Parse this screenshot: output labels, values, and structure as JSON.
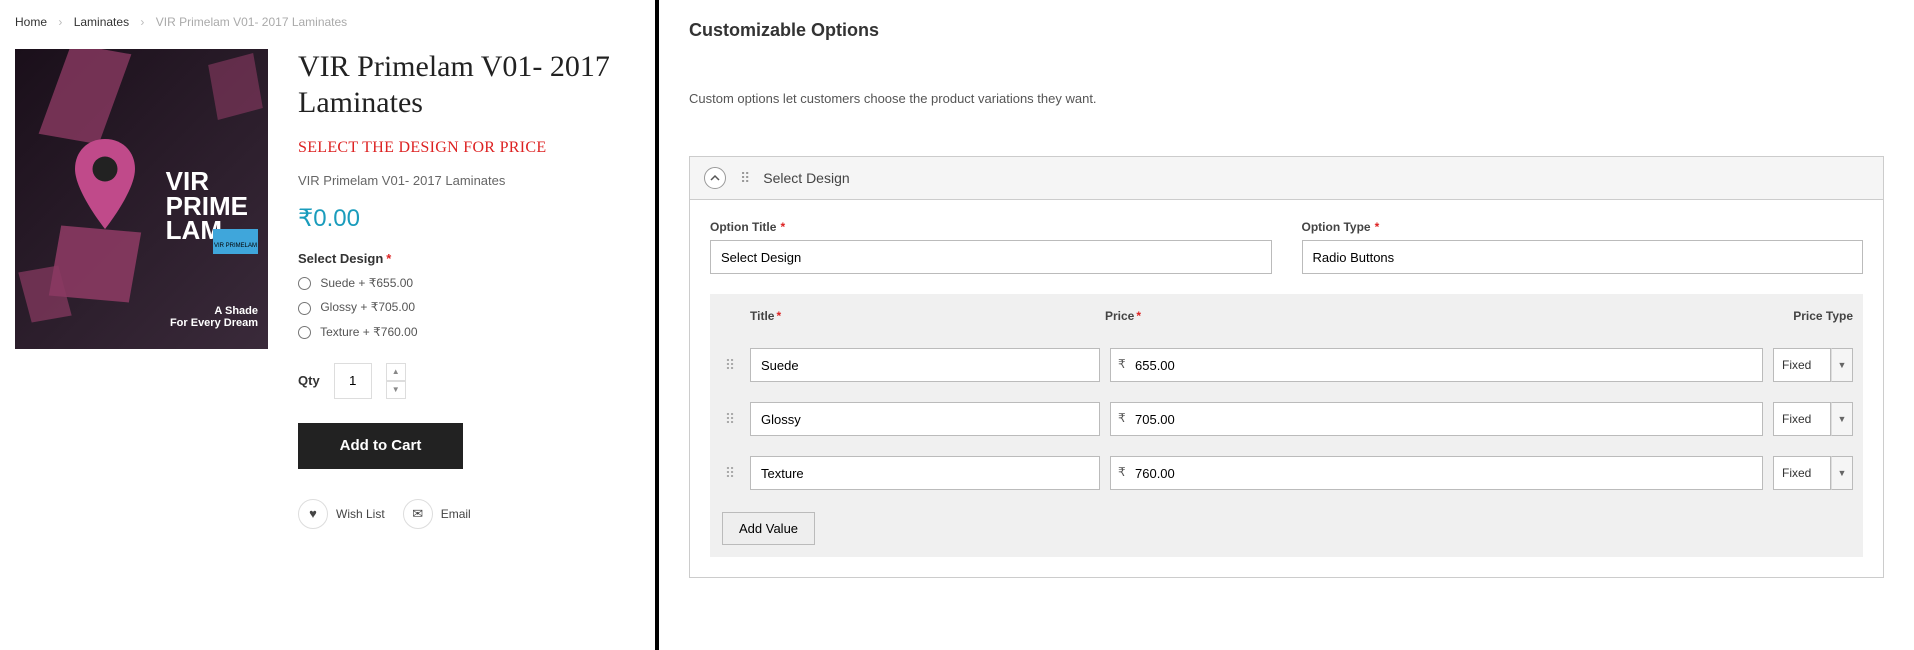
{
  "breadcrumb": {
    "home": "Home",
    "cat": "Laminates",
    "current": "VIR Primelam V01- 2017 Laminates"
  },
  "product": {
    "title": "VIR Primelam V01- 2017 Laminates",
    "select_msg": "SELECT THE DESIGN FOR PRICE",
    "subtitle": "VIR Primelam V01- 2017 Laminates",
    "price": "₹0.00",
    "option_label": "Select Design",
    "options": [
      {
        "label": "Suede + ₹655.00"
      },
      {
        "label": "Glossy + ₹705.00"
      },
      {
        "label": "Texture + ₹760.00"
      }
    ],
    "qty_label": "Qty",
    "qty_value": "1",
    "add_label": "Add to Cart",
    "wish_label": "Wish List",
    "email_label": "Email",
    "image": {
      "big_line1": "VIR",
      "big_line2": "PRIME",
      "big_line3": "LAM",
      "logo": "VIR PRIMELAM",
      "tagline1": "A Shade",
      "tagline2": "For Every Dream"
    }
  },
  "admin": {
    "heading": "Customizable Options",
    "hint": "Custom options let customers choose the product variations they want.",
    "acc_title": "Select Design",
    "option_title_label": "Option Title",
    "option_title_value": "Select Design",
    "option_type_label": "Option Type",
    "option_type_value": "Radio Buttons",
    "col_title": "Title",
    "col_price": "Price",
    "col_ptype": "Price Type",
    "rows": [
      {
        "title": "Suede",
        "price": "655.00",
        "ptype": "Fixed"
      },
      {
        "title": "Glossy",
        "price": "705.00",
        "ptype": "Fixed"
      },
      {
        "title": "Texture",
        "price": "760.00",
        "ptype": "Fixed"
      }
    ],
    "add_value": "Add Value"
  }
}
